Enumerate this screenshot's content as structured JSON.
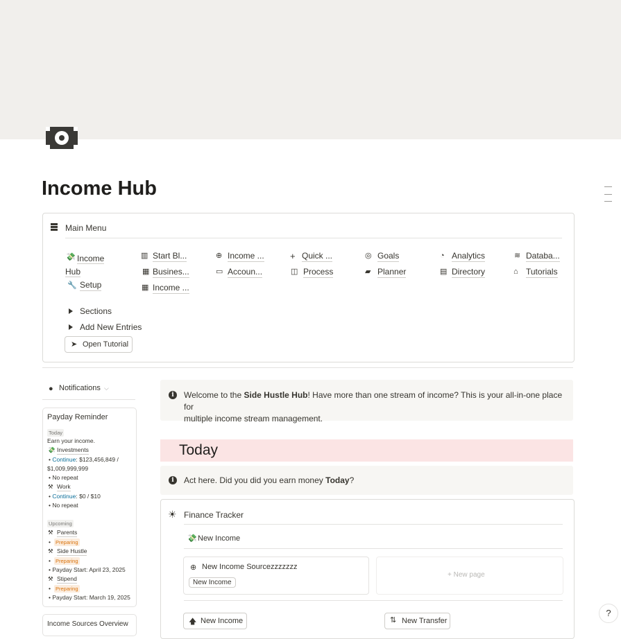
{
  "page": {
    "title": "Income Hub",
    "icon": "money-bill-icon",
    "cover_color": "#f1efec"
  },
  "main_menu": {
    "title": "Main Menu",
    "links": {
      "income_hub": "Income Hub",
      "setup": "Setup",
      "start_bl": "Start Bl...",
      "busines": "Busines...",
      "income_col3": "Income ...",
      "income_col4": "Income ...",
      "accoun": "Accoun...",
      "quick": "Quick ...",
      "process": "Process",
      "goals": "Goals",
      "planner": "Planner",
      "analytics": "Analytics",
      "directory": "Directory",
      "databa": "Databa...",
      "tutorials": "Tutorials"
    },
    "toggles": {
      "sections": "Sections",
      "add_new_entries": "Add New Entries"
    },
    "open_tutorial": "Open Tutorial"
  },
  "notifications": {
    "label": "Notifications",
    "payday": {
      "title": "Payday Reminder",
      "today_tag": "Today",
      "earn": "Earn your income.",
      "investments": "Investments",
      "continue_label": "Continue",
      "inv_amount": ": $123,456,849 /",
      "inv_total": "$1,009,999,999",
      "no_repeat": "No repeat",
      "work": "Work",
      "work_amount": ": $0 / $10",
      "upcoming_tag": "Upcoming",
      "parents": "Parents",
      "preparing": "Preparing",
      "side_hustle": "Side Hustle",
      "payday_start_1": "Payday Start: April 23, 2025",
      "stipend": "Stipend",
      "payday_start_2": "Payday Start: March 19, 2025"
    },
    "next_card_title": "Income Sources Overview"
  },
  "welcome": {
    "prefix": "Welcome to the ",
    "bold": "Side Hustle Hub",
    "suffix": "! Have more than one stream of income? This is your all-in-one place for",
    "line2": "multiple income stream management."
  },
  "today": {
    "heading": "Today",
    "prefix": "Act here. Did you did you earn money ",
    "bold": "Today",
    "suffix": "?"
  },
  "finance_tracker": {
    "title": "Finance Tracker",
    "new_income_header": "New Income",
    "card_title": "New Income Sourcezzzzzzz",
    "card_tag": "New Income",
    "new_page": "New page",
    "new_income_btn": "New Income",
    "new_transfer_btn": "New Transfer"
  },
  "help": "?"
}
